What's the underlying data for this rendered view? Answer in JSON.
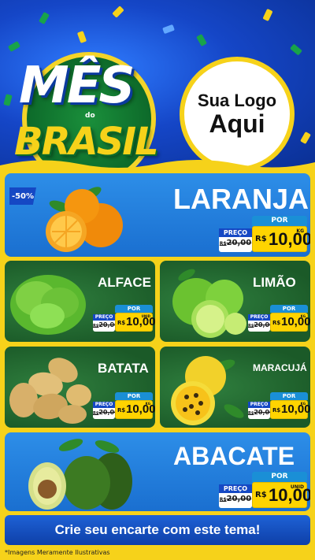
{
  "header": {
    "title_mes": "MÊS",
    "title_do": "do",
    "title_brasil": "BRASIL",
    "logo_line1": "Sua Logo",
    "logo_line2": "Aqui"
  },
  "products": {
    "laranja": {
      "name": "LARANJA",
      "badge": "-50%",
      "preco_label": "PREÇO",
      "old_prefix": "R$",
      "old_price": "20,00",
      "por_label": "POR",
      "currency": "R$",
      "price": "10,00",
      "unit": "KG"
    },
    "alface": {
      "name": "ALFACE",
      "preco_label": "PREÇO",
      "old_prefix": "R$",
      "old_price": "20,00",
      "por_label": "POR",
      "currency": "R$",
      "price": "10,00",
      "unit": "UNID"
    },
    "limao": {
      "name": "LIMÃO",
      "preco_label": "PREÇO",
      "old_prefix": "R$",
      "old_price": "20,00",
      "por_label": "POR",
      "currency": "R$",
      "price": "10,00",
      "unit": "KG"
    },
    "batata": {
      "name": "BATATA",
      "preco_label": "PREÇO",
      "old_prefix": "R$",
      "old_price": "20,00",
      "por_label": "POR",
      "currency": "R$",
      "price": "10,00",
      "unit": "KG"
    },
    "maracuja": {
      "name": "MARACUJÁ",
      "preco_label": "PREÇO",
      "old_prefix": "R$",
      "old_price": "20,00",
      "por_label": "POR",
      "currency": "R$",
      "price": "10,00",
      "unit": "KG"
    },
    "abacate": {
      "name": "ABACATE",
      "preco_label": "PREÇO",
      "old_prefix": "R$",
      "old_price": "20,00",
      "por_label": "POR",
      "currency": "R$",
      "price": "10,00",
      "unit": "UNID"
    }
  },
  "cta": {
    "label": "Crie seu encarte com este tema!"
  },
  "footer": {
    "note": "*Imagens Meramente Ilustrativas"
  },
  "colors": {
    "header_blue": "#1546c7",
    "yellow": "#f6d21a",
    "card_blue": "#1a6fd0",
    "card_green": "#1b5a28",
    "tag_blue": "#1548c4",
    "price_yellow": "#ffd400"
  }
}
